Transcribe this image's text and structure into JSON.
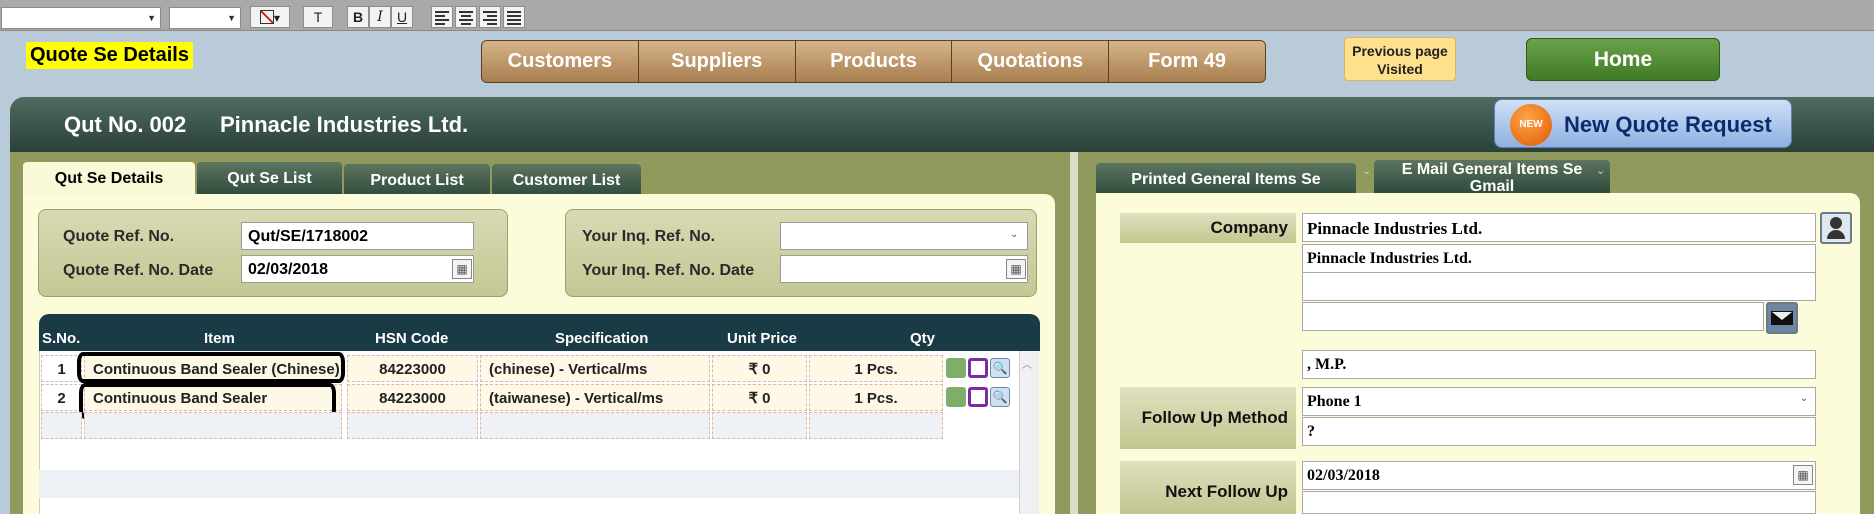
{
  "toolbar": {
    "font_name": "",
    "font_size": "",
    "bold": "B",
    "italic": "I",
    "underline": "U",
    "text_style": "T"
  },
  "page_title": "Quote Se Details",
  "nav": {
    "items": [
      {
        "label": "Customers"
      },
      {
        "label": "Suppliers"
      },
      {
        "label": "Products"
      },
      {
        "label": "Quotations"
      },
      {
        "label": "Form 49"
      }
    ]
  },
  "prev_page": {
    "line1": "Previous page",
    "line2": "Visited"
  },
  "home_label": "Home",
  "header": {
    "qut_no": "Qut No. 002",
    "company": "Pinnacle Industries Ltd.",
    "new_badge": "NEW",
    "new_quote_label": "New Quote Request"
  },
  "left_tabs": [
    {
      "label": "Qut Se Details"
    },
    {
      "label": "Qut Se List"
    },
    {
      "label": "Product List"
    },
    {
      "label": "Customer List"
    }
  ],
  "quote_form": {
    "ref_no_label": "Quote Ref. No.",
    "ref_no_value": "Qut/SE/1718002",
    "ref_date_label": "Quote Ref. No. Date",
    "ref_date_value": "02/03/2018",
    "inq_no_label": "Your Inq. Ref. No.",
    "inq_no_value": "",
    "inq_date_label": "Your Inq. Ref. No. Date",
    "inq_date_value": ""
  },
  "grid": {
    "columns": [
      "S.No.",
      "Item",
      "HSN Code",
      "Specification",
      "Unit Price",
      "Qty"
    ],
    "rows": [
      {
        "sno": "1",
        "item": "Continuous Band Sealer (Chinese)",
        "hsn": "84223000",
        "spec": "(chinese) - Vertical/ms",
        "price": "₹ 0",
        "qty": "1 Pcs."
      },
      {
        "sno": "2",
        "item": "Continuous Band Sealer",
        "hsn": "84223000",
        "spec": "(taiwanese) - Vertical/ms",
        "price": "₹ 0",
        "qty": "1 Pcs."
      }
    ]
  },
  "right_tabs": [
    {
      "label": "Printed General Items Se"
    },
    {
      "label": "E Mail General Items Se",
      "sub": "Gmail"
    }
  ],
  "customer": {
    "company_label": "Company",
    "company_value": "Pinnacle Industries Ltd.",
    "name_value": "Pinnacle Industries Ltd.",
    "line3": "",
    "email": "",
    "address": ", M.P.",
    "follow_label": "Follow Up Method",
    "follow_method": "Phone 1",
    "follow_detail": "?",
    "next_label": "Next Follow Up",
    "next_date": "02/03/2018",
    "next_note": ""
  },
  "colors": {
    "accent_yellow": "#ffff00",
    "nav_brown": "#b08a5c",
    "home_green": "#4f8a32",
    "dark_band": "#2f4a3c",
    "panel_olive": "#8f9a5c",
    "content_cream": "#fcfcdb"
  }
}
